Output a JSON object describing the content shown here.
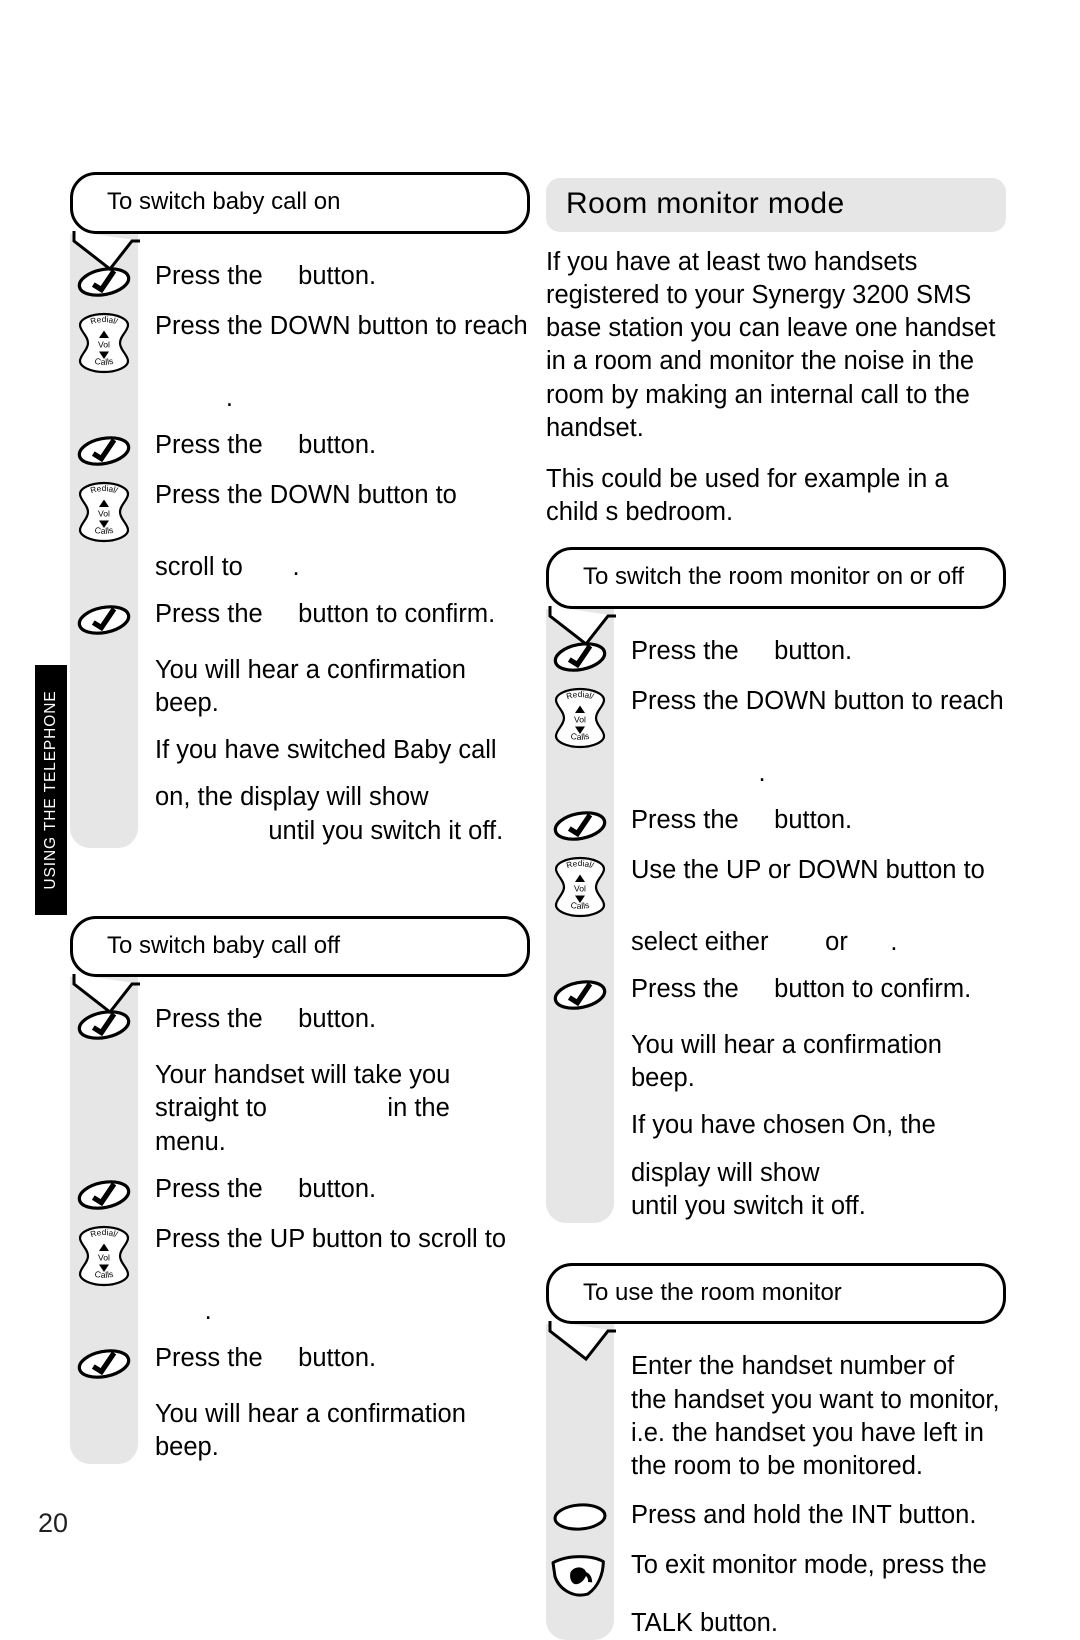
{
  "page": {
    "number": "20",
    "side_tab_label": "USING THE TELEPHONE"
  },
  "icons": {
    "ok": "ok-check-button-icon",
    "nav": "navigation-key-icon",
    "int": "int-button-icon",
    "talk": "talk-button-icon",
    "nav_top_label": "Redial/",
    "nav_mid_label": "Vol",
    "nav_bottom_label": "Calls"
  },
  "left_column": {
    "callout_baby_on": {
      "title": "To switch baby call on",
      "steps": [
        {
          "icon": "ok",
          "text": "Press the     button."
        },
        {
          "icon": "nav",
          "text": "Press the DOWN button to reach"
        },
        {
          "icon": "none",
          "text": "          ."
        },
        {
          "icon": "ok",
          "text": "Press the     button."
        },
        {
          "icon": "nav",
          "text": "Press the DOWN button to"
        },
        {
          "icon": "none",
          "text": "scroll to       ."
        },
        {
          "icon": "ok",
          "text": "Press the     button to confirm."
        },
        {
          "icon": "none",
          "text": "You will hear a confirmation"
        },
        {
          "icon": "none",
          "text": "beep."
        },
        {
          "icon": "none",
          "text": "If you have switched Baby call"
        },
        {
          "icon": "none",
          "text": "on, the display will show"
        },
        {
          "icon": "none",
          "text": "                until you switch it off."
        }
      ]
    },
    "callout_baby_off": {
      "title": "To switch baby call off",
      "steps": [
        {
          "icon": "ok",
          "text": "Press the     button."
        },
        {
          "icon": "none",
          "text": "Your handset will take you"
        },
        {
          "icon": "none",
          "text": "straight to                 in the"
        },
        {
          "icon": "none",
          "text": "menu."
        },
        {
          "icon": "ok",
          "text": "Press the     button."
        },
        {
          "icon": "nav",
          "text": "Press the UP button to scroll to"
        },
        {
          "icon": "none",
          "text": "       ."
        },
        {
          "icon": "ok",
          "text": "Press the     button."
        },
        {
          "icon": "none",
          "text": "You will hear a confirmation"
        },
        {
          "icon": "none",
          "text": "beep."
        }
      ]
    }
  },
  "right_column": {
    "heading": "Room monitor mode",
    "intro_paragraphs": [
      "If you have at least two handsets registered to your Synergy 3200 SMS base station you can leave one handset in a room and monitor the noise in the room by making an internal call to the handset.",
      "This could be used for example in a child s bedroom."
    ],
    "callout_monitor_onoff": {
      "title": "To switch the room monitor on or off",
      "steps": [
        {
          "icon": "ok",
          "text": "Press the     button."
        },
        {
          "icon": "nav",
          "text": "Press the DOWN button to reach"
        },
        {
          "icon": "none",
          "text": "                  ."
        },
        {
          "icon": "ok",
          "text": "Press the     button."
        },
        {
          "icon": "nav",
          "text": "Use the UP or DOWN button to"
        },
        {
          "icon": "none",
          "text": "select either        or      ."
        },
        {
          "icon": "ok",
          "text": "Press the     button to confirm."
        },
        {
          "icon": "none",
          "text": "You will hear a confirmation"
        },
        {
          "icon": "none",
          "text": "beep."
        },
        {
          "icon": "none",
          "text": "If you have chosen On, the"
        },
        {
          "icon": "none",
          "text": "display will show"
        },
        {
          "icon": "none",
          "text": "until you switch it off."
        }
      ]
    },
    "callout_use_monitor": {
      "title": "To use the room monitor",
      "steps": [
        {
          "icon": "none",
          "text": "Enter the handset number of"
        },
        {
          "icon": "none",
          "text": "the handset you want to monitor,"
        },
        {
          "icon": "none",
          "text": "i.e. the handset you have left in"
        },
        {
          "icon": "none",
          "text": "the room to be monitored."
        },
        {
          "icon": "int",
          "text": "Press and hold the INT button."
        },
        {
          "icon": "talk",
          "text": "To exit monitor mode, press the"
        },
        {
          "icon": "none",
          "text": "TALK button."
        }
      ]
    }
  },
  "colors": {
    "gutter_grey": "#e6e6e6",
    "tab_black": "#000000",
    "text_black": "#000000"
  }
}
